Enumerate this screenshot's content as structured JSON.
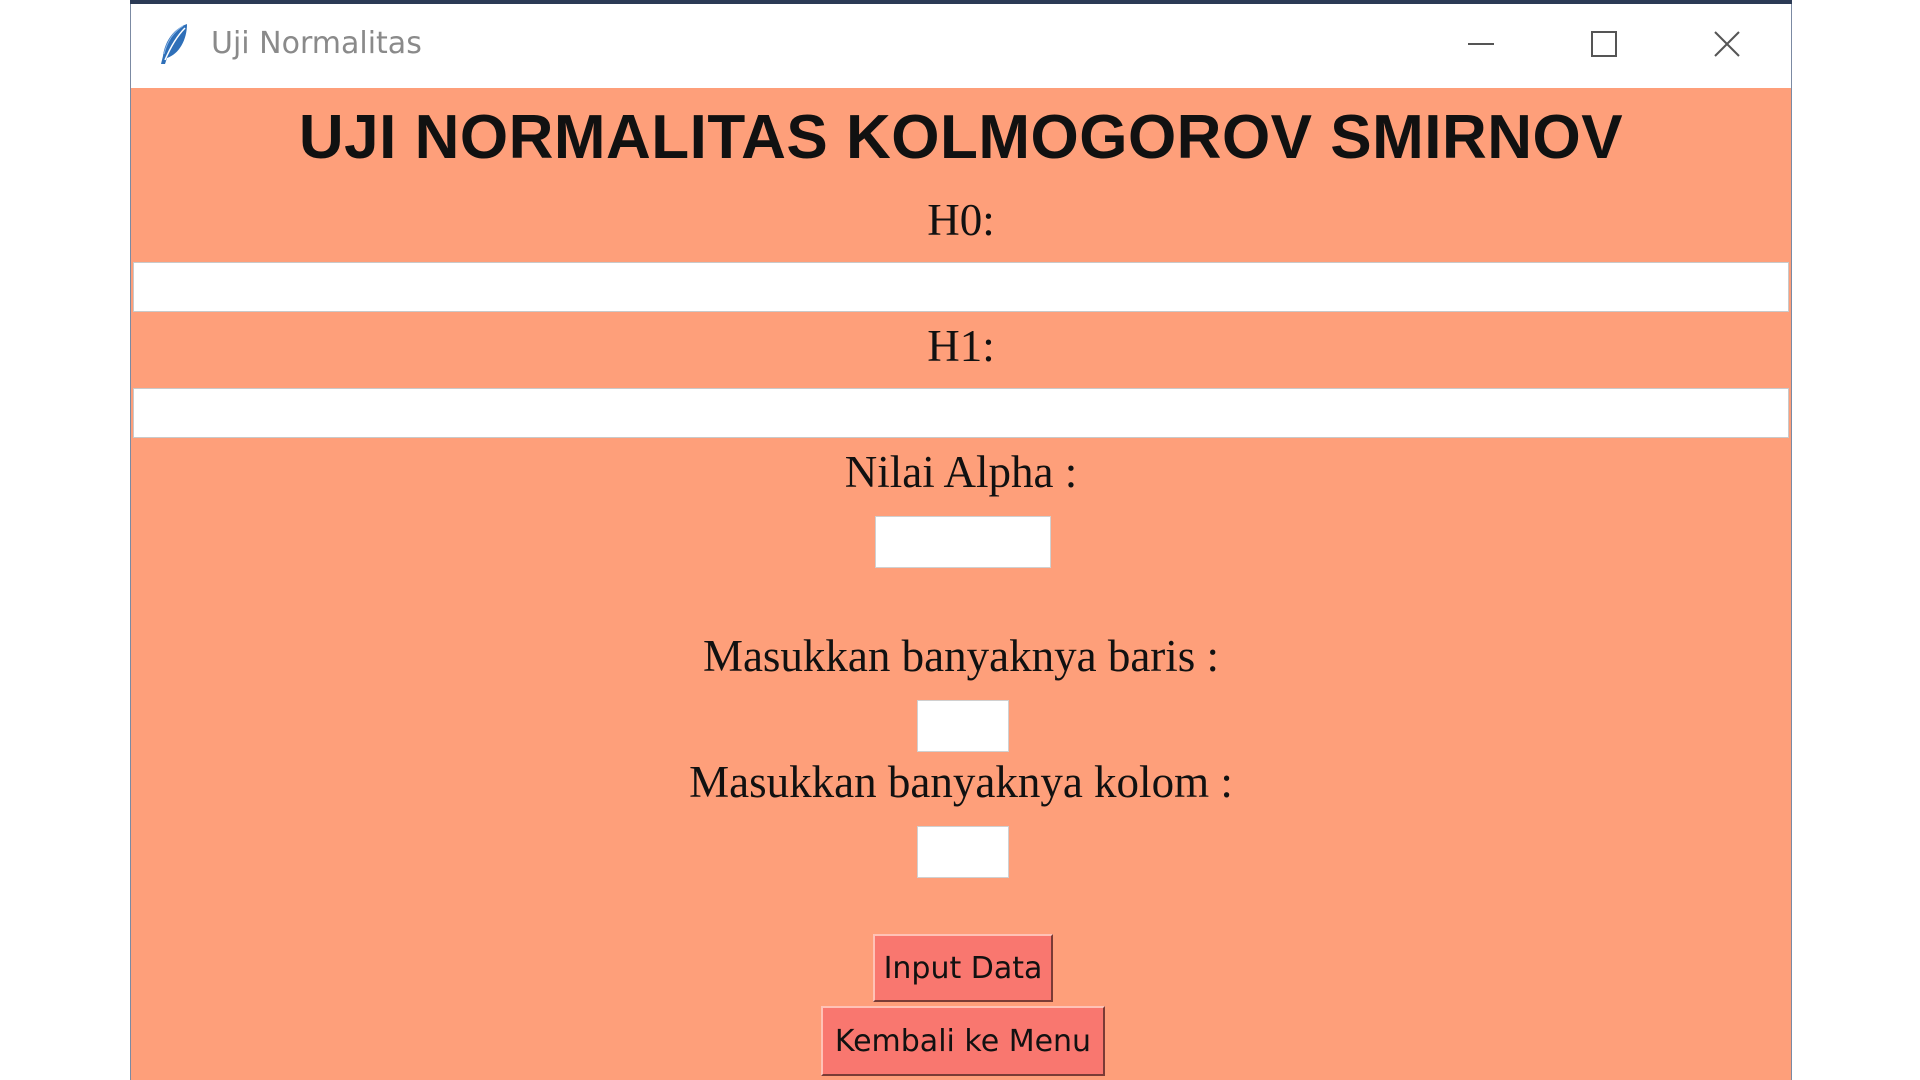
{
  "window": {
    "title": "Uji Normalitas",
    "icon": "feather-icon",
    "controls": [
      "minimize-icon",
      "maximize-icon",
      "close-icon"
    ]
  },
  "form": {
    "heading": "UJI NORMALITAS KOLMOGOROV SMIRNOV",
    "h0_label": "H0:",
    "h0_value": "",
    "h1_label": "H1:",
    "h1_value": "",
    "alpha_label": "Nilai Alpha :",
    "alpha_value": "",
    "rows_label": "Masukkan banyaknya baris :",
    "rows_value": "",
    "cols_label": "Masukkan banyaknya kolom :",
    "cols_value": ""
  },
  "buttons": {
    "input_data": "Input Data",
    "back_to_menu": "Kembali ke Menu"
  },
  "colors": {
    "background": "#fe9f7a",
    "button": "#f9776f"
  }
}
